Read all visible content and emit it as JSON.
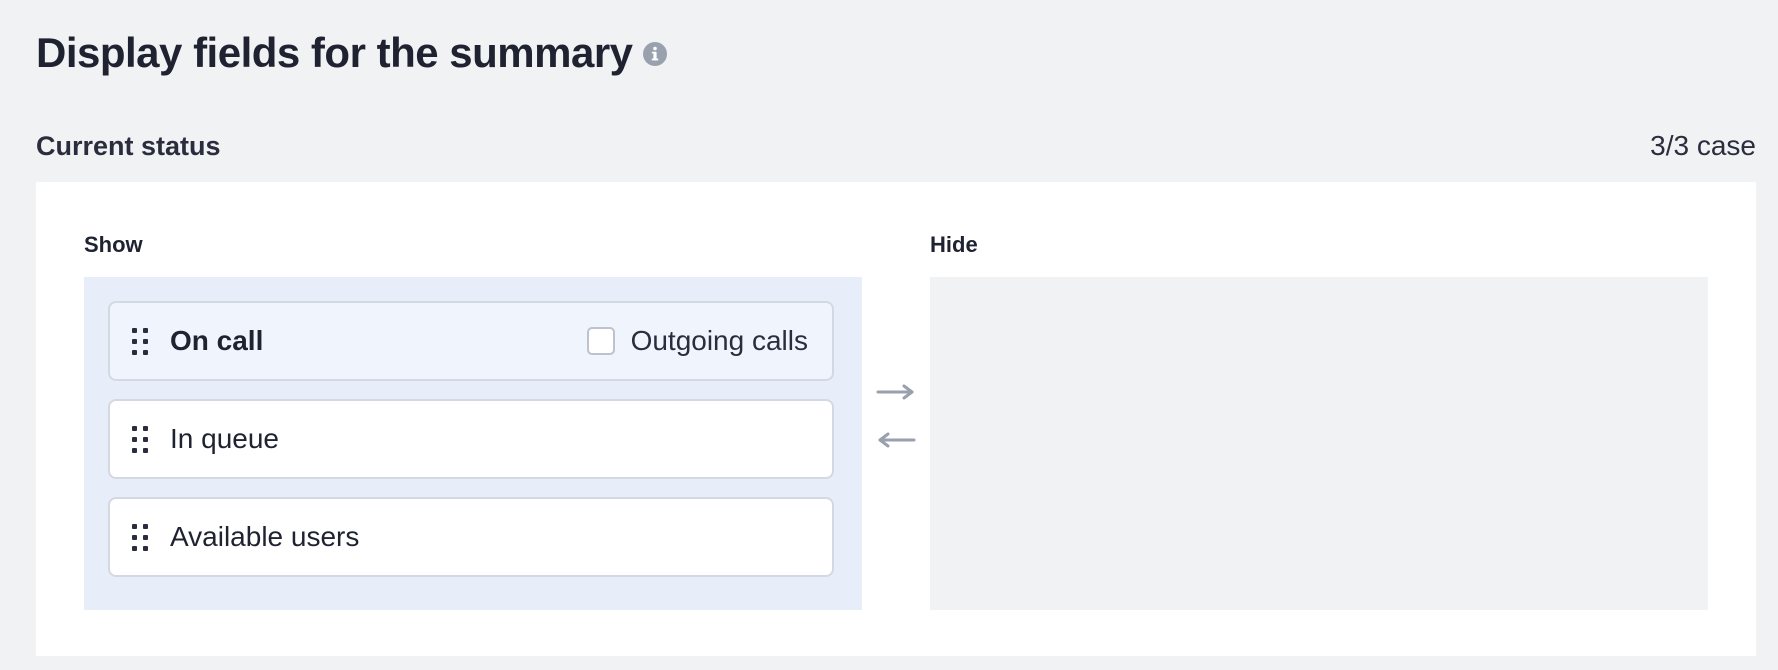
{
  "header": {
    "title": "Display fields for the summary",
    "info_icon": "info-circle-icon"
  },
  "section": {
    "label": "Current status",
    "case_count": "3/3 case"
  },
  "show_column": {
    "label": "Show",
    "items": [
      {
        "label": "On call",
        "active": true,
        "option": {
          "label": "Outgoing calls",
          "checked": false
        }
      },
      {
        "label": "In queue",
        "active": false
      },
      {
        "label": "Available users",
        "active": false
      }
    ]
  },
  "hide_column": {
    "label": "Hide",
    "items": []
  },
  "transfer": {
    "to_hide_icon": "arrow-right-icon",
    "to_show_icon": "arrow-left-icon"
  },
  "colors": {
    "page_background": "#f1f2f4",
    "show_zone": "#e8eef9",
    "hide_zone": "#f1f2f4",
    "active_item": "#eff4fd",
    "item_border": "#d4d8e1",
    "icon_gray": "#9aa1ae",
    "text": "#1f2230"
  }
}
